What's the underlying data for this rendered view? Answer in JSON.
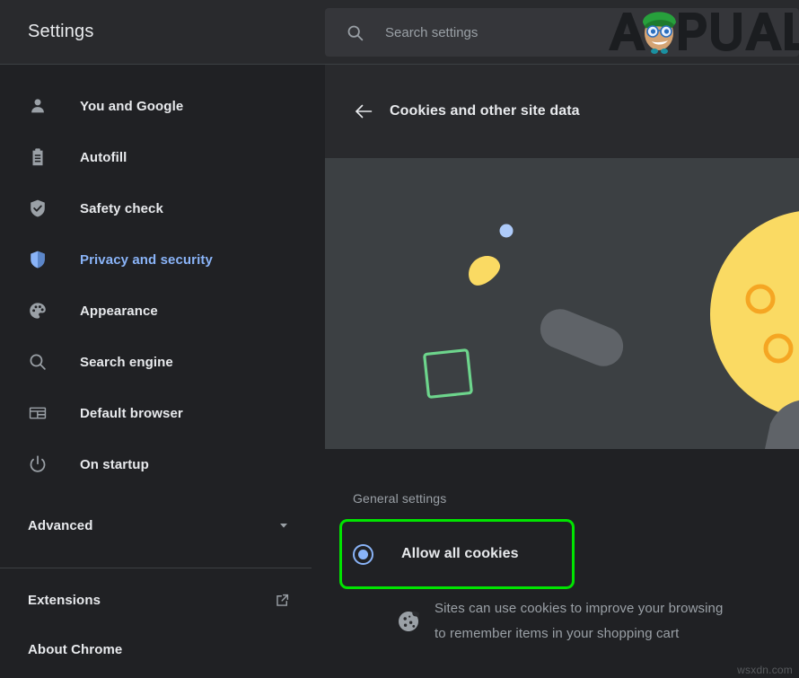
{
  "window": {
    "title": "Settings"
  },
  "search": {
    "icon": "search-icon",
    "placeholder": "Search settings",
    "value": ""
  },
  "branding": {
    "watermark_logo": "appuals-logo",
    "watermark_text": "APPUALS",
    "footer_watermark": "wsxdn.com"
  },
  "sidebar": {
    "items": [
      {
        "label": "You and Google",
        "icon": "person-icon",
        "active": false
      },
      {
        "label": "Autofill",
        "icon": "clipboard-icon",
        "active": false
      },
      {
        "label": "Safety check",
        "icon": "shield-check-icon",
        "active": false
      },
      {
        "label": "Privacy and security",
        "icon": "shield-icon",
        "active": true
      },
      {
        "label": "Appearance",
        "icon": "palette-icon",
        "active": false
      },
      {
        "label": "Search engine",
        "icon": "magnifier-icon",
        "active": false
      },
      {
        "label": "Default browser",
        "icon": "browser-window-icon",
        "active": false
      },
      {
        "label": "On startup",
        "icon": "power-icon",
        "active": false
      }
    ],
    "advanced": {
      "label": "Advanced",
      "icon": "chevron-down-icon"
    },
    "footer_items": [
      {
        "label": "Extensions",
        "icon": "external-link-icon"
      },
      {
        "label": "About Chrome",
        "icon": ""
      }
    ]
  },
  "content": {
    "back_icon": "arrow-left-icon",
    "title": "Cookies and other site data",
    "hero": {
      "illustration": "cookie-illustration",
      "background": "#3c4043",
      "cookie_color": "#fada63",
      "cookie_hole_color": "#f5a623",
      "crumb_color": "#fada63",
      "dot_color": "#aecbfa",
      "square_outline_color": "#6dd58c",
      "pill_color": "#5f6368"
    },
    "section_label": "General settings",
    "options": [
      {
        "label": "Allow all cookies",
        "selected": true,
        "highlight_color": "#00e400",
        "radio_color": "#8ab4f8",
        "description_icon": "cookie-icon",
        "description_lines": [
          "Sites can use cookies to improve your browsing",
          "to remember items in your shopping cart"
        ]
      }
    ]
  }
}
